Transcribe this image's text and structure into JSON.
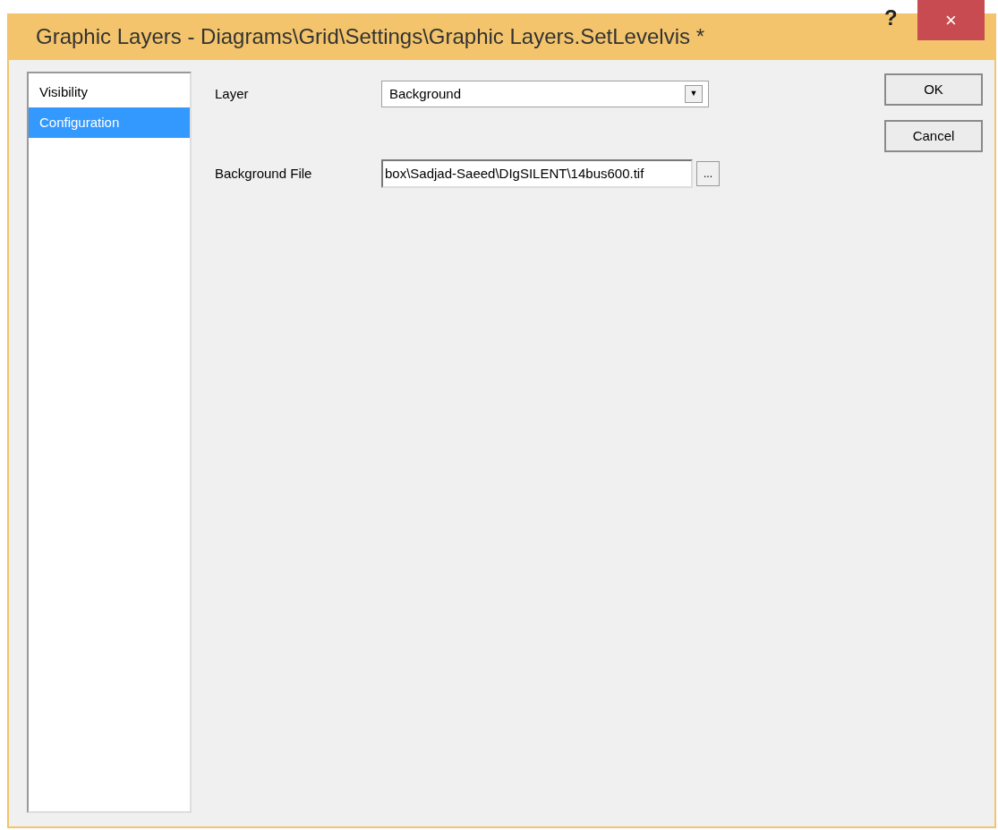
{
  "window": {
    "title": "Graphic Layers - Diagrams\\Grid\\Settings\\Graphic Layers.SetLevelvis *",
    "help": "?",
    "close": "×"
  },
  "sidebar": {
    "items": [
      {
        "label": "Visibility",
        "selected": false
      },
      {
        "label": "Configuration",
        "selected": true
      }
    ]
  },
  "form": [
    {
      "kind": "dropdown",
      "label": "Layer",
      "value": "Background",
      "caret": "▼"
    },
    {
      "kind": "file",
      "label": "Background File",
      "value": "box\\Sadjad-Saeed\\DIgSILENT\\14bus600.tif",
      "browse": "..."
    }
  ],
  "buttons": [
    "OK",
    "Cancel"
  ]
}
